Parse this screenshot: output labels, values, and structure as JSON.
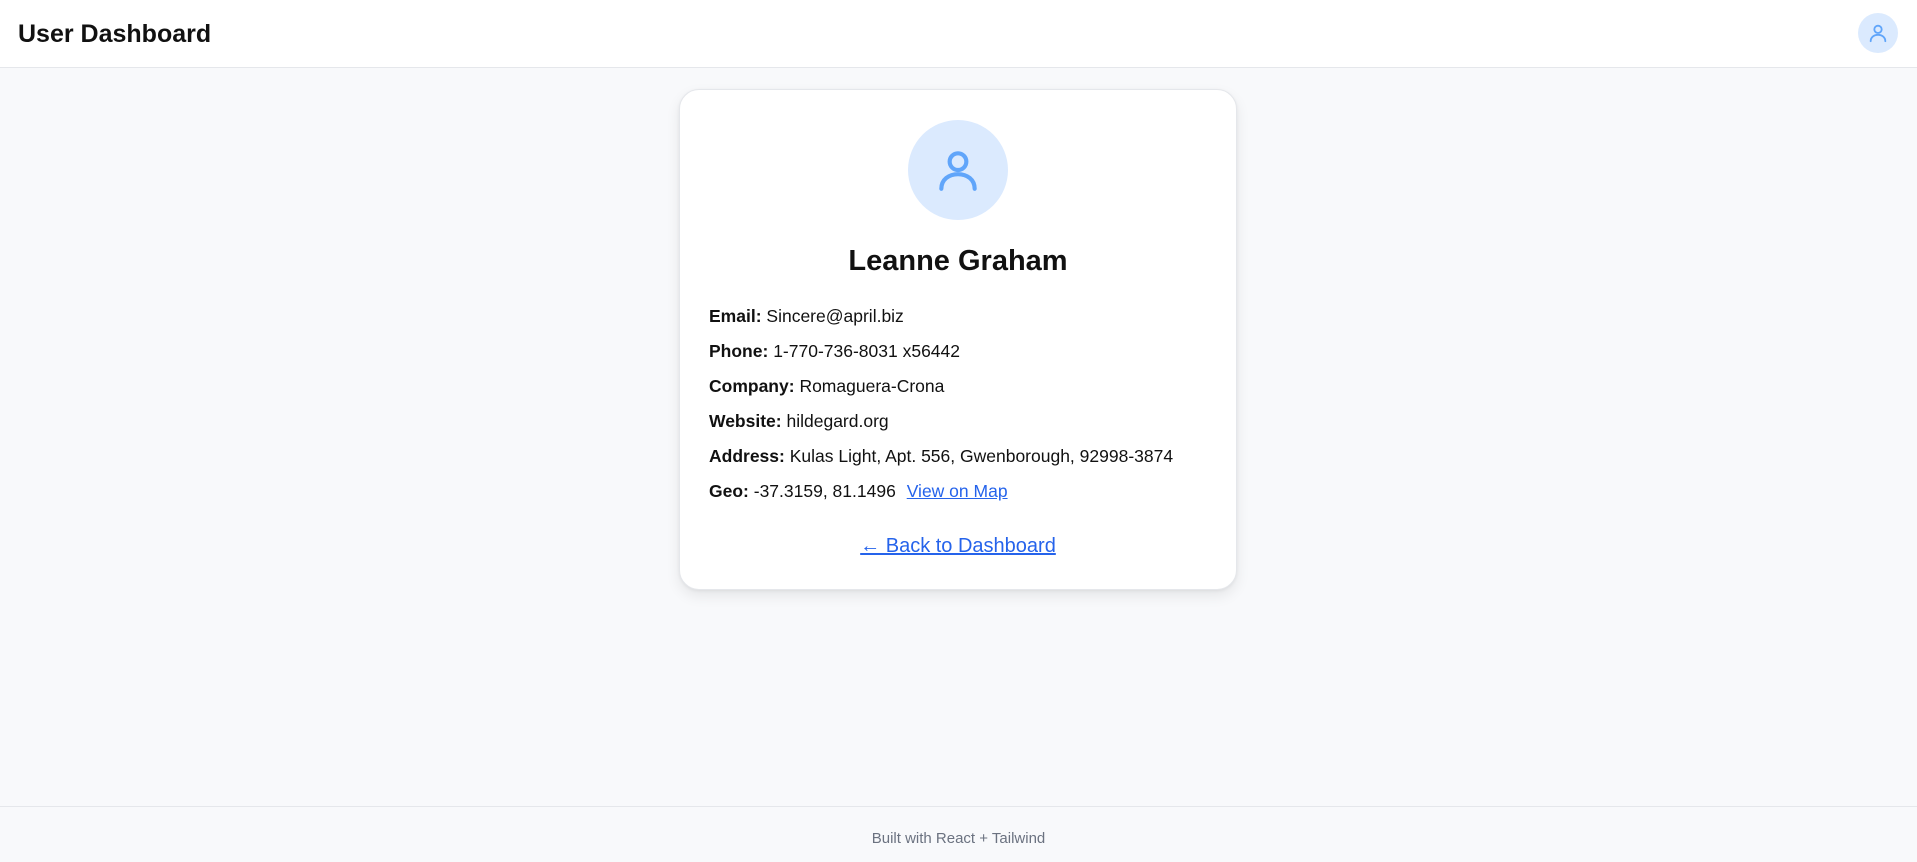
{
  "header": {
    "title": "User Dashboard",
    "avatar_icon": "user-icon"
  },
  "profile": {
    "avatar_icon": "user-icon",
    "name": "Leanne Graham",
    "fields": {
      "email": {
        "label": "Email:",
        "value": "Sincere@april.biz"
      },
      "phone": {
        "label": "Phone:",
        "value": "1-770-736-8031 x56442"
      },
      "company": {
        "label": "Company:",
        "value": "Romaguera-Crona"
      },
      "website": {
        "label": "Website:",
        "value": "hildegard.org"
      },
      "address": {
        "label": "Address:",
        "value": "Kulas Light, Apt. 556, Gwenborough, 92998-3874"
      },
      "geo": {
        "label": "Geo:",
        "value": "-37.3159, 81.1496",
        "map_link": "View on Map"
      }
    },
    "back_link": "← Back to Dashboard"
  },
  "footer": {
    "text": "Built with React + Tailwind"
  },
  "colors": {
    "accent": "#2563eb",
    "avatar_bg": "#dbeafe",
    "avatar_icon": "#60a5fa",
    "page_bg": "#f8f9fb"
  }
}
